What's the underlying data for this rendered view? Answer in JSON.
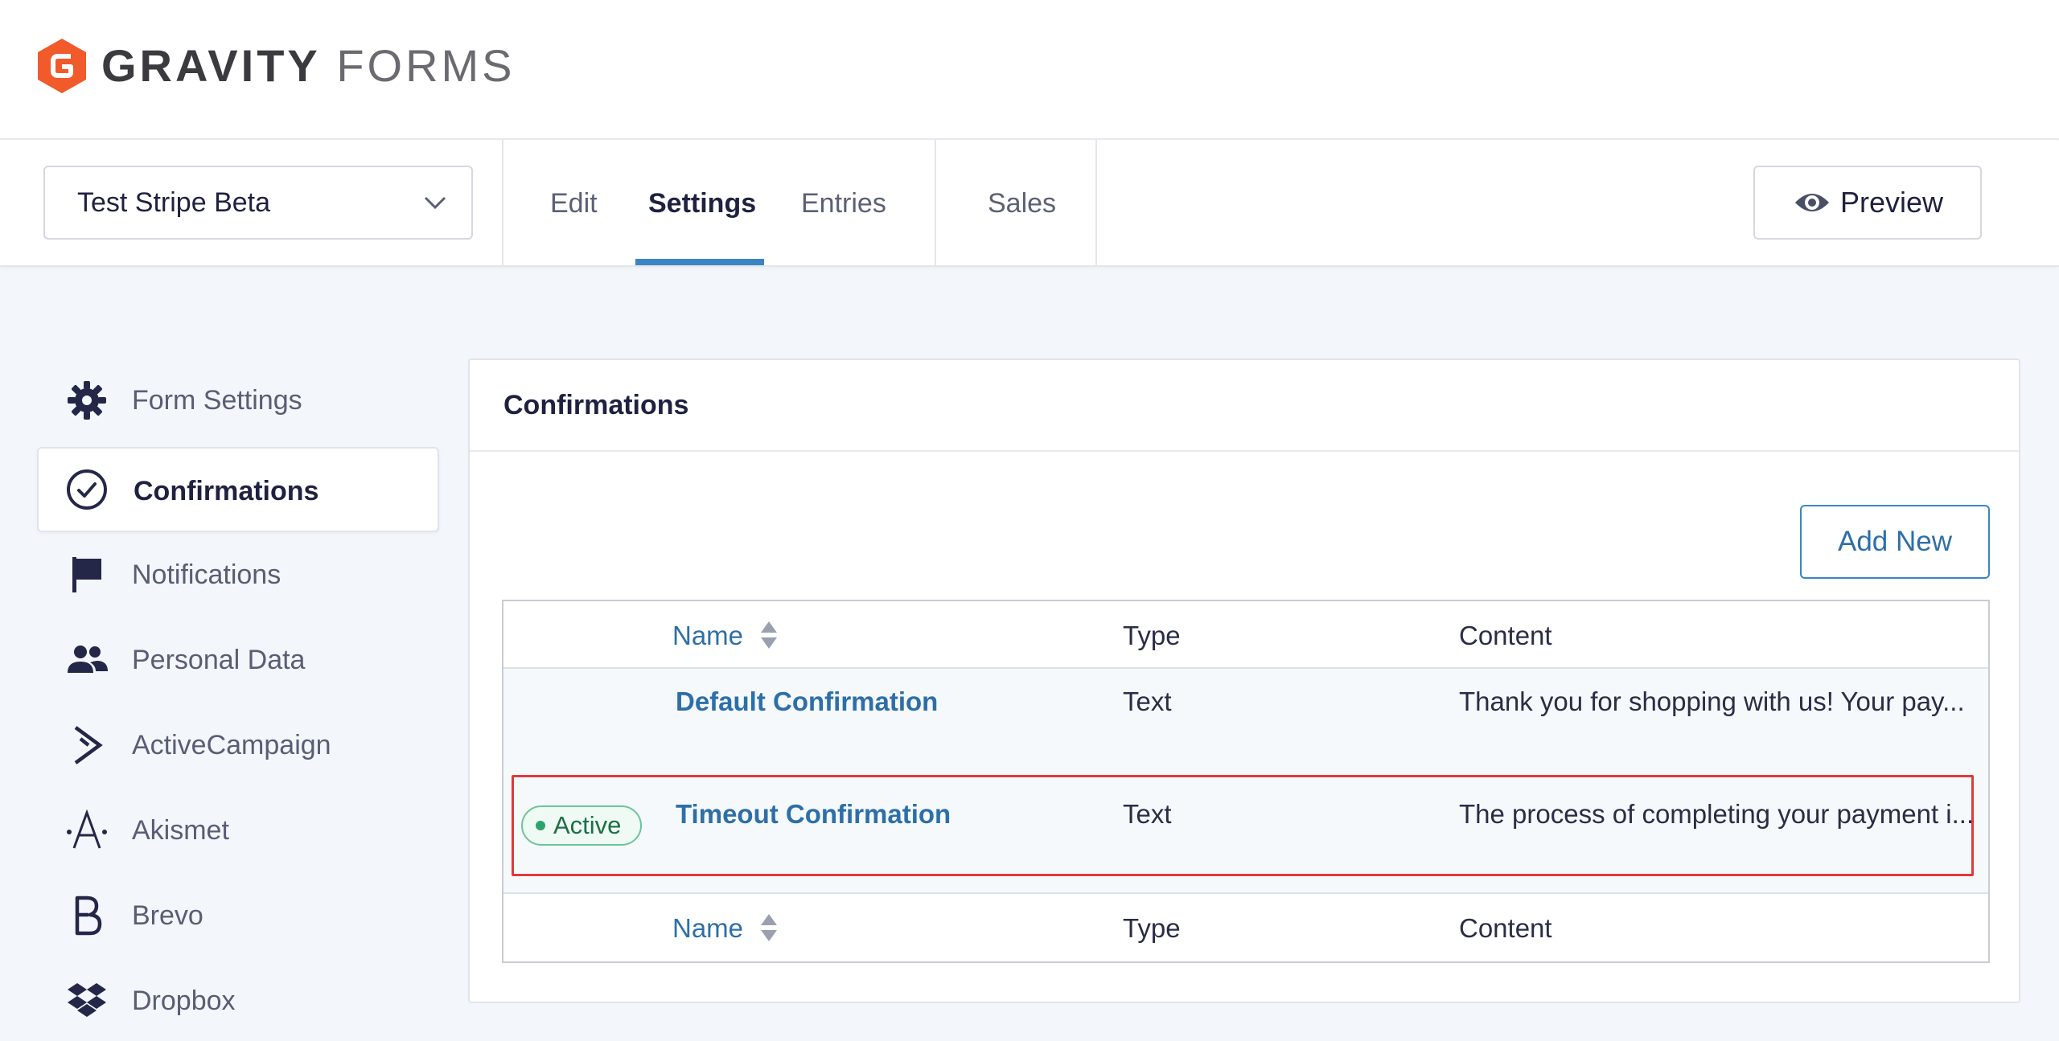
{
  "brand": {
    "name_bold": "GRAVITY",
    "name_light": "FORMS",
    "accent_color": "#f15a2b"
  },
  "toolbar": {
    "form_selector": {
      "value": "Test Stripe Beta"
    },
    "tabs": [
      {
        "label": "Edit"
      },
      {
        "label": "Settings",
        "active": true
      },
      {
        "label": "Entries"
      },
      {
        "label": "Sales"
      }
    ],
    "preview_label": "Preview"
  },
  "sidebar": {
    "items": [
      {
        "label": "Form Settings",
        "icon": "gear-icon"
      },
      {
        "label": "Confirmations",
        "icon": "check-circle-icon",
        "active": true
      },
      {
        "label": "Notifications",
        "icon": "flag-icon"
      },
      {
        "label": "Personal Data",
        "icon": "users-icon"
      },
      {
        "label": "ActiveCampaign",
        "icon": "activecampaign-icon"
      },
      {
        "label": "Akismet",
        "icon": "akismet-icon"
      },
      {
        "label": "Brevo",
        "icon": "brevo-icon"
      },
      {
        "label": "Dropbox",
        "icon": "dropbox-icon"
      }
    ]
  },
  "panel": {
    "title": "Confirmations",
    "add_new_label": "Add New",
    "table": {
      "columns": [
        "Name",
        "Type",
        "Content"
      ],
      "rows": [
        {
          "name": "Default Confirmation",
          "type": "Text",
          "content": "Thank you for shopping with us! Your pay...",
          "badge": ""
        },
        {
          "name": "Timeout Confirmation",
          "type": "Text",
          "content": "The process of completing your payment i...",
          "badge": "Active"
        }
      ]
    }
  }
}
